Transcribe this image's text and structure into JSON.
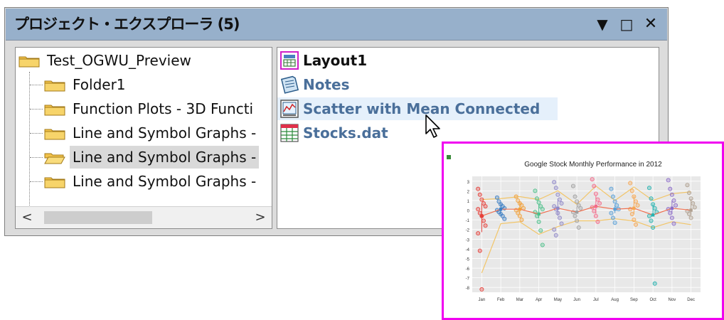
{
  "window": {
    "title": "プロジェクト・エクスプローラ (5)",
    "buttons": {
      "menu": "▼",
      "maximize": "□",
      "close": "✕"
    }
  },
  "tree": {
    "items": [
      {
        "label": "Test_OGWU_Preview",
        "icon": "folder-icon",
        "selected": false
      },
      {
        "label": "Folder1",
        "icon": "folder-icon",
        "selected": false
      },
      {
        "label": "Function Plots - 3D Functi",
        "icon": "folder-icon",
        "selected": false
      },
      {
        "label": "Line and Symbol Graphs -",
        "icon": "folder-icon",
        "selected": false
      },
      {
        "label": "Line and Symbol Graphs -",
        "icon": "folder-open-icon",
        "selected": true
      },
      {
        "label": "Line and Symbol Graphs -",
        "icon": "folder-icon",
        "selected": false
      }
    ],
    "scroll": {
      "left": "<",
      "right": ">"
    }
  },
  "content": {
    "items": [
      {
        "label": "Layout1",
        "icon": "layout-icon",
        "color": "#111111"
      },
      {
        "label": "Notes",
        "icon": "notes-icon",
        "color": "#4a6f9a"
      },
      {
        "label": "Scatter with Mean Connected",
        "icon": "graph-icon",
        "color": "#4a6f9a",
        "hover": true
      },
      {
        "label": "Stocks.dat",
        "icon": "workbook-icon",
        "color": "#4a6f9a"
      }
    ]
  },
  "preview": {
    "border_color": "#f000f0"
  },
  "chart_data": {
    "type": "scatter",
    "title": "Google Stock Monthly Performance in 2012",
    "categories": [
      "Jan",
      "Feb",
      "Mar",
      "Apr",
      "May",
      "Jun",
      "Jul",
      "Aug",
      "Sep",
      "Oct",
      "Nov",
      "Dec"
    ],
    "yticks": [
      3,
      2,
      1,
      0,
      -1,
      -2,
      -3,
      -4,
      -5,
      -6,
      -7,
      -8
    ],
    "ylim": [
      -8.5,
      3.5
    ],
    "colors": [
      "#e6403a",
      "#3c7fc4",
      "#f2a13a",
      "#4cc08a",
      "#8f88c8",
      "#a0a0a0",
      "#f46a8a",
      "#5aa0d8",
      "#f7a650",
      "#27b3b0",
      "#8c6cc8",
      "#b0a090"
    ],
    "points": [
      [
        2.2,
        1.6,
        1.1,
        0.7,
        0.4,
        0.1,
        -0.3,
        -0.6,
        -1.1,
        -1.6,
        -2.4,
        -4.2,
        -8.2
      ],
      [
        1.3,
        0.9,
        0.6,
        0.4,
        0.2,
        0.0,
        -0.2,
        -0.4,
        -0.6,
        -0.9
      ],
      [
        1.4,
        1.0,
        0.7,
        0.5,
        0.2,
        0.0,
        -0.3,
        -0.6,
        -1.0
      ],
      [
        2.0,
        1.2,
        0.8,
        0.4,
        0.1,
        -0.2,
        -0.6,
        -1.2,
        -2.1,
        -3.6
      ],
      [
        2.9,
        2.3,
        1.6,
        1.1,
        0.7,
        0.4,
        0.1,
        -0.3,
        -0.8,
        -1.4,
        -2.0,
        -2.6
      ],
      [
        2.5,
        1.4,
        0.9,
        0.5,
        0.2,
        -0.2,
        -0.6,
        -1.1,
        -1.8
      ],
      [
        3.2,
        2.5,
        1.7,
        1.1,
        0.7,
        0.3,
        -0.1,
        -0.6,
        -1.2
      ],
      [
        2.2,
        1.4,
        0.9,
        0.5,
        0.1,
        -0.3,
        -0.8,
        -1.3
      ],
      [
        2.8,
        2.0,
        1.4,
        0.9,
        0.5,
        0.1,
        -0.4,
        -1.0,
        -1.5
      ],
      [
        2.3,
        1.2,
        0.6,
        0.2,
        -0.2,
        -0.6,
        -1.1,
        -1.8,
        -7.6
      ],
      [
        3.1,
        2.2,
        1.6,
        1.0,
        0.5,
        0.1,
        -0.3,
        -0.8,
        -1.4
      ],
      [
        2.6,
        1.8,
        1.2,
        0.7,
        0.3,
        -0.1,
        -0.4,
        -0.8
      ]
    ],
    "mean": [
      -0.6,
      0.1,
      0.1,
      -0.4,
      0.2,
      -0.2,
      0.4,
      0.1,
      0.2,
      -0.5,
      0.2,
      0.0
    ],
    "upper": [
      1.1,
      1.2,
      1.4,
      1.1,
      2.0,
      0.6,
      2.5,
      1.0,
      2.4,
      1.0,
      1.7,
      1.9
    ],
    "lower": [
      -6.5,
      -1.4,
      -1.2,
      -2.5,
      -1.7,
      -1.1,
      -1.1,
      -0.9,
      -1.1,
      -1.8,
      -1.2,
      -1.5
    ],
    "grid": true
  }
}
